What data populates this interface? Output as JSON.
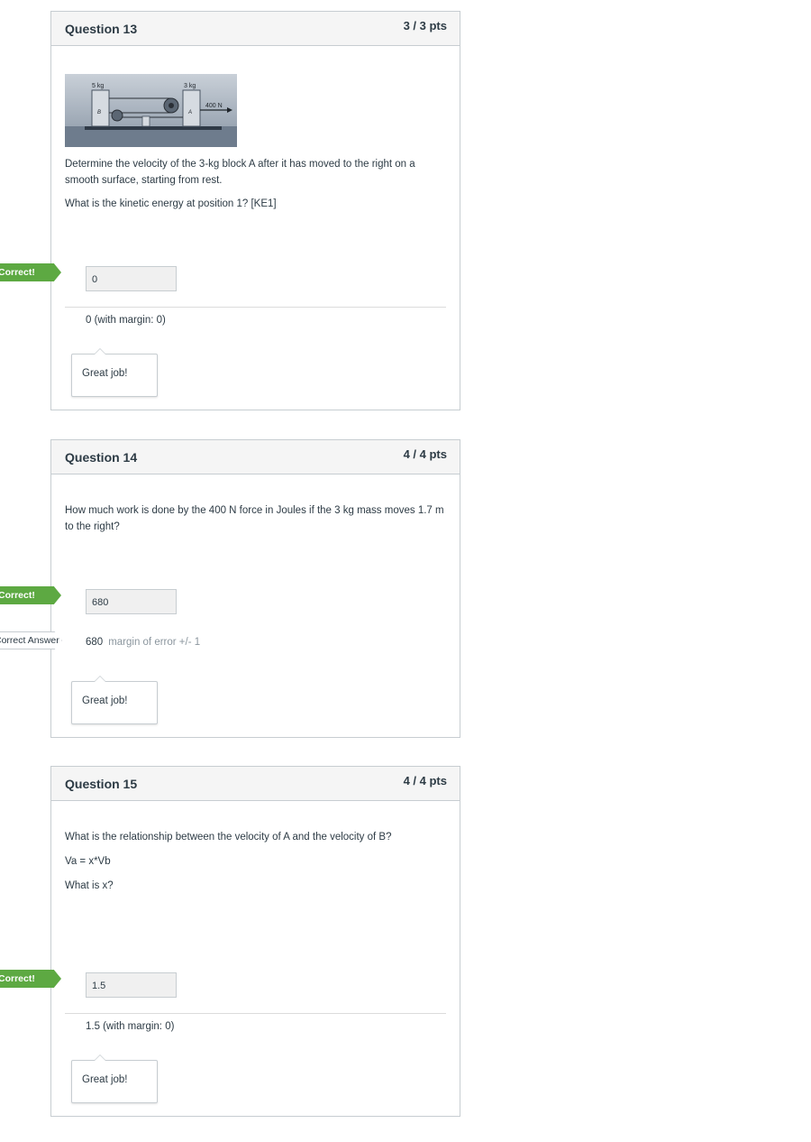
{
  "q13": {
    "title": "Question 13",
    "points": "3 / 3 pts",
    "figure": {
      "mass_b": "5 kg",
      "mass_a": "3 kg",
      "force": "400 N",
      "label_b": "B",
      "label_a": "A"
    },
    "text1": "Determine the velocity of the 3-kg block A after it has moved to the right on a smooth surface, starting from rest.",
    "text2": "What is the kinetic energy at position 1? [KE1]",
    "flag": "Correct!",
    "answer": "0",
    "margin_text": "0 (with margin: 0)",
    "feedback": "Great job!"
  },
  "q14": {
    "title": "Question 14",
    "points": "4 / 4 pts",
    "text1": "How much work is done by the 400 N force in Joules if the 3 kg mass moves 1.7 m to the right?",
    "flag": "Correct!",
    "answer": "680",
    "correct_answer_flag": "Correct Answer",
    "correct_value": "680",
    "correct_margin": "margin of error +/- 1",
    "feedback": "Great job!"
  },
  "q15": {
    "title": "Question 15",
    "points": "4 / 4 pts",
    "text1": "What is the relationship between the velocity of A and the velocity of B?",
    "text2": "Va = x*Vb",
    "text3": "What is x?",
    "flag": "Correct!",
    "answer": "1.5",
    "margin_text": "1.5 (with margin: 0)",
    "feedback": "Great job!"
  },
  "colors": {
    "correct_green": "#5da942",
    "border": "#c7cdd1",
    "header_bg": "#f5f5f5"
  }
}
